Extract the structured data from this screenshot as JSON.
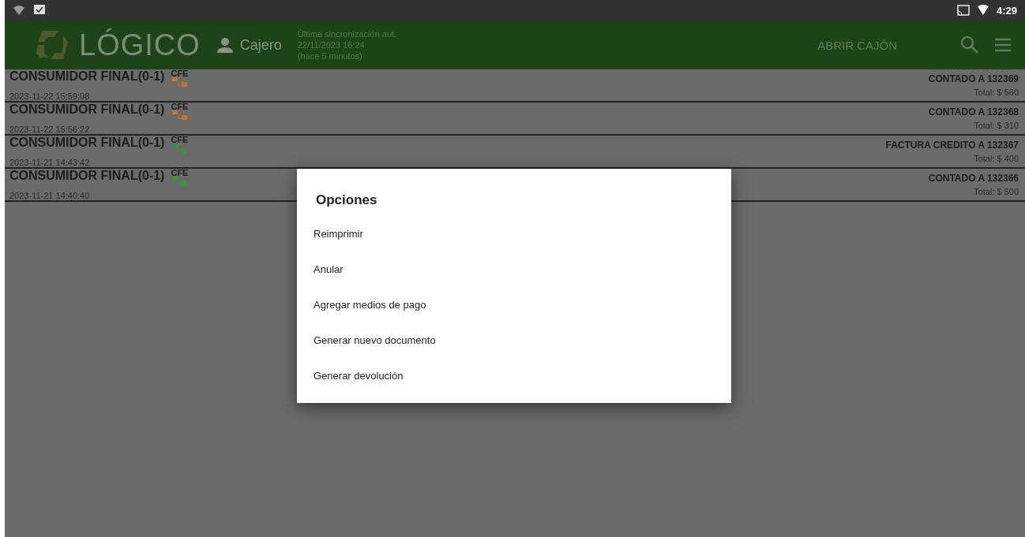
{
  "status_bar": {
    "time": "4:29"
  },
  "app_bar": {
    "logo": "LÓGICO",
    "user": "Cajero",
    "sync": [
      "Última sincronización aut.",
      "22/11/2023 16:24",
      "(hace 5 minutos)"
    ],
    "action": "ABRIR CAJÓN"
  },
  "documents": [
    {
      "client": "CONSUMIDOR FINAL(0-1)",
      "badge": "CFE",
      "color": "#c8761e",
      "date": "2023-11-22 15:59:08",
      "doc": "CONTADO A 132369",
      "total": "Total: $  560"
    },
    {
      "client": "CONSUMIDOR FINAL(0-1)",
      "badge": "CFE",
      "color": "#c8761e",
      "date": "2023-11-22 15:56:22",
      "doc": "CONTADO A 132368",
      "total": "Total: $  310"
    },
    {
      "client": "CONSUMIDOR FINAL(0-1)",
      "badge": "CFE",
      "color": "#2e9a3a",
      "date": "2023-11-21 14:43:42",
      "doc": "FACTURA CREDITO A 132367",
      "total": "Total: $  400"
    },
    {
      "client": "CONSUMIDOR FINAL(0-1)",
      "badge": "CFE",
      "color": "#2e9a3a",
      "date": "2023-11-21 14:40:40",
      "doc": "CONTADO A 132366",
      "total": "Total: $  500"
    }
  ],
  "dialog": {
    "title": "Opciones",
    "options": [
      "Reimprimir",
      "Anular",
      "Agregar medios de pago",
      "Generar nuevo documento",
      "Generar devolución"
    ]
  }
}
